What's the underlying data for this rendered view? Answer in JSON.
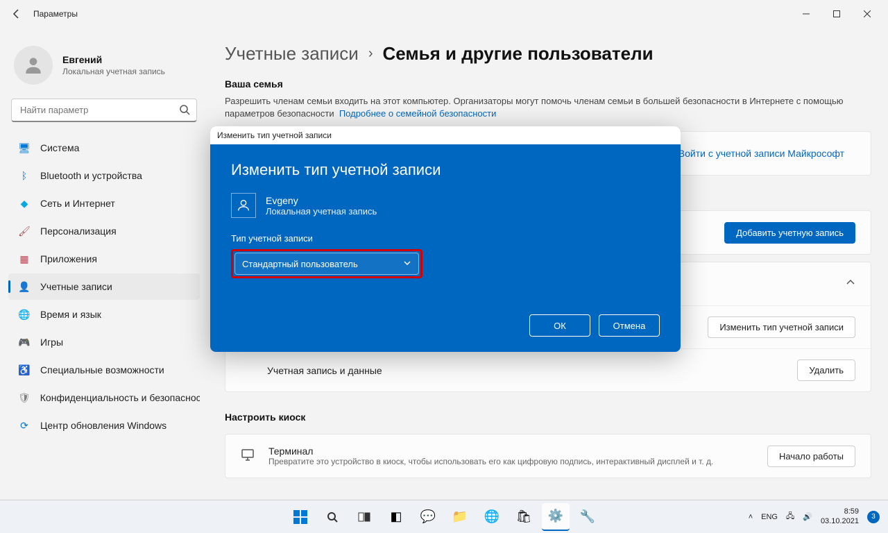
{
  "titlebar": {
    "title": "Параметры"
  },
  "profile": {
    "name": "Евгений",
    "sub": "Локальная учетная запись"
  },
  "search": {
    "placeholder": "Найти параметр"
  },
  "nav": [
    {
      "key": "system",
      "label": "Система",
      "icon": "🖥",
      "cls": "ic-monitor"
    },
    {
      "key": "bluetooth",
      "label": "Bluetooth и устройства",
      "icon": "ᛒ",
      "cls": "ic-bt"
    },
    {
      "key": "network",
      "label": "Сеть и Интернет",
      "icon": "◆",
      "cls": "ic-wifi"
    },
    {
      "key": "personalization",
      "label": "Персонализация",
      "icon": "🖌",
      "cls": "ic-brush"
    },
    {
      "key": "apps",
      "label": "Приложения",
      "icon": "▦",
      "cls": "ic-apps"
    },
    {
      "key": "accounts",
      "label": "Учетные записи",
      "icon": "👤",
      "cls": "ic-user",
      "active": true
    },
    {
      "key": "time",
      "label": "Время и язык",
      "icon": "🌐",
      "cls": "ic-time"
    },
    {
      "key": "gaming",
      "label": "Игры",
      "icon": "🎮",
      "cls": "ic-game"
    },
    {
      "key": "accessibility",
      "label": "Специальные возможности",
      "icon": "♿",
      "cls": "ic-access"
    },
    {
      "key": "privacy",
      "label": "Конфиденциальность и безопасность",
      "icon": "🛡",
      "cls": "ic-shield"
    },
    {
      "key": "update",
      "label": "Центр обновления Windows",
      "icon": "⟳",
      "cls": "ic-update"
    }
  ],
  "breadcrumb": {
    "parent": "Учетные записи",
    "current": "Семья и другие пользователи"
  },
  "family": {
    "title": "Ваша семья",
    "desc": "Разрешить членам семьи входить на этот компьютер. Организаторы могут помочь членам семьи в большей безопасности в Интернете с помощью параметров безопасности",
    "link": "Подробнее о семейной безопасности",
    "signin_btn": "Войти с учетной записи Майкрософт"
  },
  "others": {
    "add_btn": "Добавить учетную запись",
    "change_type_btn": "Изменить тип учетной записи",
    "account_data_label": "Учетная запись и данные",
    "delete_btn": "Удалить"
  },
  "kiosk": {
    "title": "Настроить киоск",
    "terminal": "Терминал",
    "desc": "Превратите это устройство в киоск, чтобы использовать его как цифровую подпись, интерактивный дисплей и т. д.",
    "start_btn": "Начало работы"
  },
  "dialog": {
    "window_title": "Изменить тип учетной записи",
    "heading": "Изменить тип учетной записи",
    "user_name": "Evgeny",
    "user_sub": "Локальная учетная запись",
    "type_label": "Тип учетной записи",
    "selected": "Стандартный пользователь",
    "ok": "ОК",
    "cancel": "Отмена"
  },
  "taskbar": {
    "lang": "ENG",
    "time": "8:59",
    "date": "03.10.2021",
    "badge": "3"
  }
}
